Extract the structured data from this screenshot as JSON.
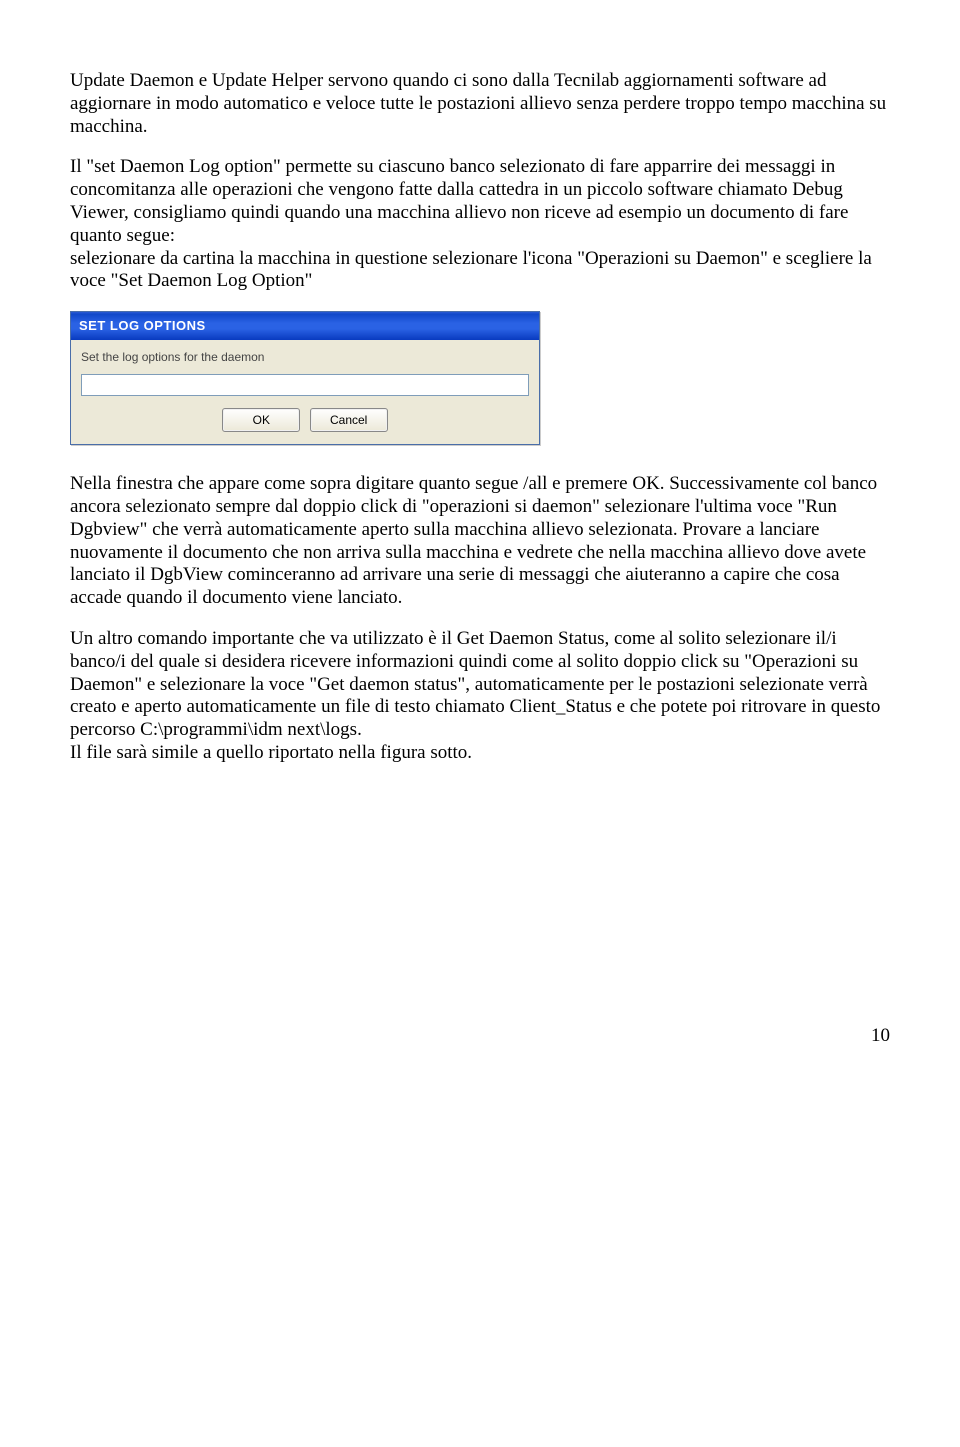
{
  "paragraphs": {
    "p1": "Update Daemon e Update Helper servono quando ci sono dalla Tecnilab aggiornamenti software ad aggiornare in modo automatico e veloce tutte le postazioni allievo senza perdere troppo tempo macchina su macchina.",
    "p2": "Il \"set Daemon Log option\" permette su ciascuno banco selezionato di fare apparrire dei messaggi in concomitanza alle operazioni che vengono fatte dalla cattedra in un piccolo software chiamato Debug Viewer, consigliamo quindi quando una macchina allievo non riceve ad esempio un documento di fare quanto segue:",
    "p3": "selezionare da cartina la macchina in questione selezionare l'icona \"Operazioni su Daemon\" e scegliere la voce \"Set Daemon Log Option\"",
    "p4": "Nella finestra che appare come sopra digitare quanto segue /all e premere OK. Successivamente col banco ancora selezionato sempre dal doppio click di \"operazioni si daemon\" selezionare l'ultima voce \"Run Dgbview\" che verrà automaticamente aperto sulla macchina allievo selezionata. Provare a lanciare nuovamente il documento che non arriva sulla macchina e vedrete che nella macchina allievo dove avete lanciato il DgbView cominceranno ad arrivare una serie di messaggi che aiuteranno a capire che cosa accade quando il documento viene lanciato.",
    "p5": "Un altro comando importante che va utilizzato è il Get Daemon Status, come al solito selezionare il/i banco/i del quale si desidera ricevere informazioni quindi come al solito doppio click su \"Operazioni su Daemon\" e selezionare la voce \"Get daemon status\", automaticamente per le postazioni selezionate verrà creato e aperto automaticamente un file di testo chiamato Client_Status e che potete poi ritrovare in questo percorso C:\\programmi\\idm next\\logs.",
    "p6": "Il file sarà simile a quello riportato nella figura sotto."
  },
  "dialog": {
    "title": "SET LOG OPTIONS",
    "description": "Set the log options for the daemon",
    "input_value": "",
    "ok_label": "OK",
    "cancel_label": "Cancel"
  },
  "page_number": "10"
}
